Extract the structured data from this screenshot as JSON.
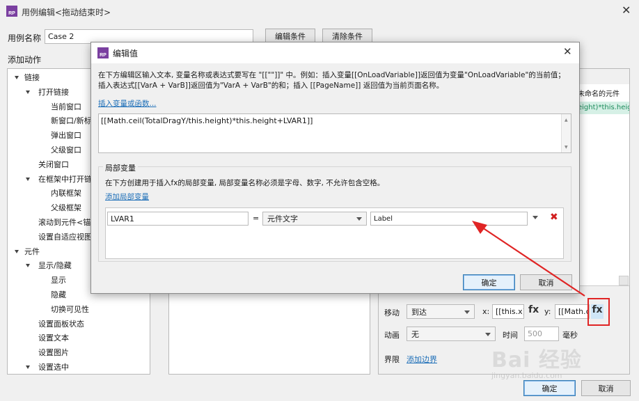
{
  "outer": {
    "title": "用例编辑<拖动结束时>",
    "case_name_label": "用例名称",
    "case_name_value": "Case 2",
    "edit_condition": "编辑条件",
    "clear_condition": "清除条件",
    "add_action_label": "添加动作",
    "tree": [
      {
        "label": "链接",
        "level": 0,
        "toggle": true
      },
      {
        "label": "打开链接",
        "level": 1,
        "toggle": true
      },
      {
        "label": "当前窗口",
        "level": 2
      },
      {
        "label": "新窗口/新标",
        "level": 2
      },
      {
        "label": "弹出窗口",
        "level": 2
      },
      {
        "label": "父级窗口",
        "level": 2
      },
      {
        "label": "关闭窗口",
        "level": 1
      },
      {
        "label": "在框架中打开链",
        "level": 1,
        "toggle": true
      },
      {
        "label": "内联框架",
        "level": 2
      },
      {
        "label": "父级框架",
        "level": 2
      },
      {
        "label": "滚动到元件<锚",
        "level": 1
      },
      {
        "label": "设置自适应视图",
        "level": 1
      },
      {
        "label": "元件",
        "level": 0,
        "toggle": true
      },
      {
        "label": "显示/隐藏",
        "level": 1,
        "toggle": true
      },
      {
        "label": "显示",
        "level": 2
      },
      {
        "label": "隐藏",
        "level": 2
      },
      {
        "label": "切换可见性",
        "level": 2
      },
      {
        "label": "设置面板状态",
        "level": 1
      },
      {
        "label": "设置文本",
        "level": 1
      },
      {
        "label": "设置图片",
        "level": 1
      },
      {
        "label": "设置选中",
        "level": 1,
        "toggle": true
      }
    ],
    "right_header": "未命名的元件",
    "right_row_value": "eight)*this.heig",
    "move_label": "移动",
    "move_select": "到达",
    "x_label": "x:",
    "x_value": "[[this.x]]",
    "fx_label": "fx",
    "y_label": "y:",
    "y_value": "[[Math.ce",
    "animation_label": "动画",
    "animation_select": "无",
    "time_label": "时间",
    "time_value": "500",
    "ms_label": "毫秒",
    "bounds_label": "界限",
    "add_bounds": "添加边界",
    "ok": "确定",
    "cancel": "取消"
  },
  "dialog": {
    "title": "编辑值",
    "desc": "在下方编辑区输入文本, 变量名称或表达式要写在 \"[[\"\"]]\" 中。例如：插入变量[[OnLoadVariable]]返回值为变量\"OnLoadVariable\"的当前值；插入表达式[[VarA + VarB]]返回值为\"VarA + VarB\"的和；插入 [[PageName]] 返回值为当前页面名称。",
    "insert_link": "插入变量或函数...",
    "expression": "[[Math.ceil(TotalDragY/this.height)*this.height+LVAR1]]",
    "local_vars_title": "局部变量",
    "local_vars_desc": "在下方创建用于插入fx的局部变量, 局部变量名称必须是字母、数字, 不允许包含空格。",
    "add_local_var": "添加局部变量",
    "var_name": "LVAR1",
    "equals": "=",
    "var_type": "元件文字",
    "var_target": "Label",
    "ok": "确定",
    "cancel": "取消"
  },
  "watermark": {
    "brand": "Bai 经验",
    "url": "jingyan.baidu.com"
  }
}
